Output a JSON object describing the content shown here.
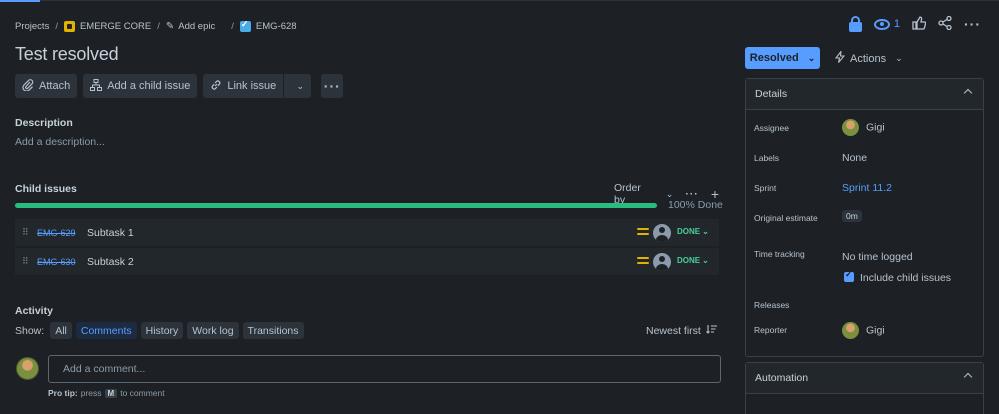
{
  "breadcrumb": {
    "projects": "Projects",
    "project": "EMERGE CORE",
    "add_epic": "Add epic",
    "issue_key": "EMG-628"
  },
  "header": {
    "watchers": "1",
    "title": "Test resolved"
  },
  "toolbar": {
    "attach": "Attach",
    "add_child": "Add a child issue",
    "link_issue": "Link issue"
  },
  "description": {
    "label": "Description",
    "placeholder": "Add a description..."
  },
  "child_issues": {
    "label": "Child issues",
    "order_by": "Order by",
    "progress_label": "100% Done",
    "progress": 1.0,
    "items": [
      {
        "key": "EMG-629",
        "summary": "Subtask 1",
        "status": "DONE"
      },
      {
        "key": "EMG-630",
        "summary": "Subtask 2",
        "status": "DONE"
      }
    ]
  },
  "activity": {
    "label": "Activity",
    "show_label": "Show:",
    "filters": [
      "All",
      "Comments",
      "History",
      "Work log",
      "Transitions"
    ],
    "active_filter": "Comments",
    "sort": "Newest first",
    "comment_placeholder": "Add a comment...",
    "protip_bold": "Pro tip:",
    "protip_press": "press",
    "protip_key": "M",
    "protip_rest": "to comment"
  },
  "sidebar": {
    "status": "Resolved",
    "actions": "Actions",
    "details_title": "Details",
    "assignee_label": "Assignee",
    "assignee": "Gigi",
    "labels_label": "Labels",
    "labels": "None",
    "sprint_label": "Sprint",
    "sprint": "Sprint 11.2",
    "estimate_label": "Original estimate",
    "estimate": "0m",
    "tracking_label": "Time tracking",
    "tracking": "No time logged",
    "include_child": "Include child issues",
    "releases_label": "Releases",
    "reporter_label": "Reporter",
    "reporter": "Gigi",
    "automation_title": "Automation"
  },
  "colors": {
    "background": "#1d2125",
    "accent": "#579dff",
    "done_green": "#4bce97",
    "progress_green": "#2abb7f",
    "priority_medium": "#e2b203"
  }
}
